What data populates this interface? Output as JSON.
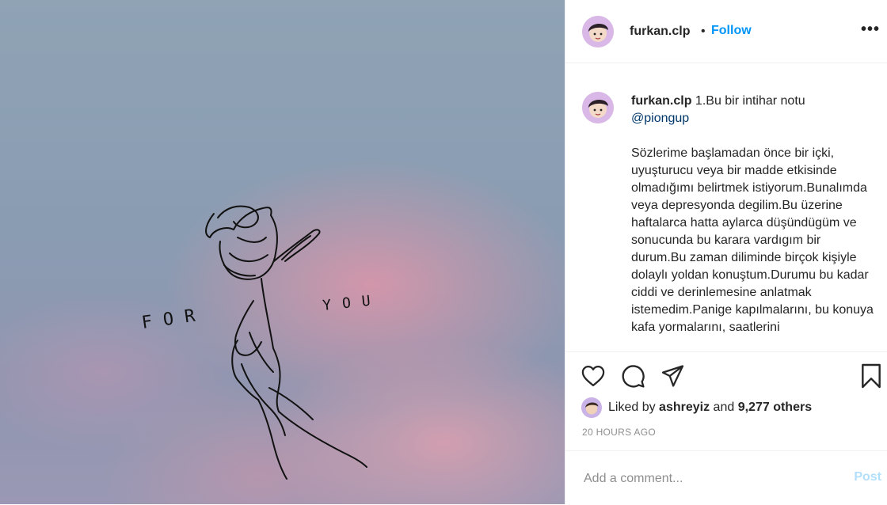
{
  "post": {
    "username": "furkan.clp",
    "follow_label": "Follow",
    "more_label": "•••",
    "caption_title": "1.Bu bir intihar notu",
    "caption_mention": "@piongup",
    "caption_body": "Sözlerime başlamadan önce bir içki, uyuşturucu veya bir madde etkisinde olmadığımı belirtmek istiyorum.Bunalımda veya depresyonda degilim.Bu üzerine haftalarca hatta aylarca düşündügüm ve sonucunda bu karara vardıgım bir durum.Bu zaman diliminde birçok kişiyle dolaylı yoldan konuştum.Durumu bu kadar ciddi ve derinlemesine anlatmak istemedim.Panige kapılmalarını, bu konuya kafa yormalarını, saatlerini",
    "liked_by_prefix": "Liked by",
    "liked_by_user": "ashreyiz",
    "liked_by_and": "and",
    "liked_by_others": "9,277 others",
    "timestamp": "20 HOURS AGO",
    "comment_placeholder": "Add a comment...",
    "post_label": "Post"
  },
  "image_text": {
    "left": "FOR",
    "right": "YOU"
  },
  "icons": {
    "like": "heart-icon",
    "comment": "comment-bubble-icon",
    "share": "paper-plane-icon",
    "save": "bookmark-icon"
  },
  "colors": {
    "link": "#0095f6",
    "mention": "#00376b",
    "muted": "#8e8e8e",
    "post_disabled": "#b2dffc"
  }
}
